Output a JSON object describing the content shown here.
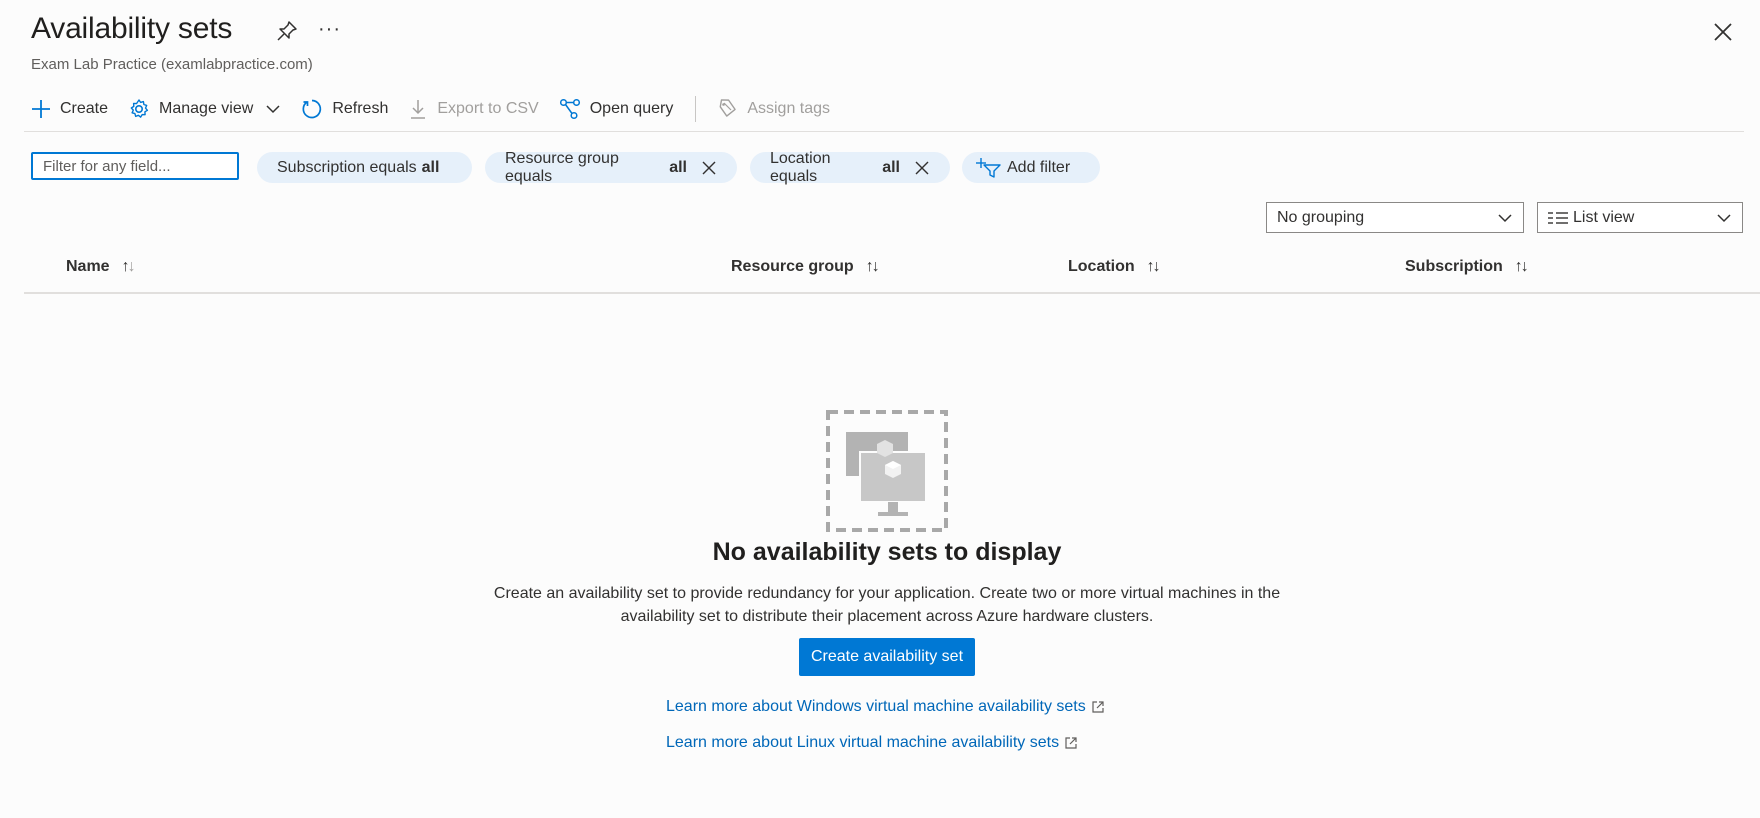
{
  "header": {
    "title": "Availability sets",
    "subtitle": "Exam Lab Practice (examlabpractice.com)",
    "more": "···"
  },
  "toolbar": {
    "create": "Create",
    "manage_view": "Manage view",
    "refresh": "Refresh",
    "export_csv": "Export to CSV",
    "open_query": "Open query",
    "assign_tags": "Assign tags"
  },
  "filters": {
    "search_placeholder": "Filter for any field...",
    "subscription": {
      "label": "Subscription equals",
      "value": "all"
    },
    "resource_group": {
      "label": "Resource group equals",
      "value": "all"
    },
    "location": {
      "label": "Location equals",
      "value": "all"
    },
    "add_filter": "Add filter"
  },
  "view": {
    "grouping": "No grouping",
    "layout": "List view"
  },
  "table": {
    "columns": [
      "Name",
      "Resource group",
      "Location",
      "Subscription"
    ]
  },
  "empty_state": {
    "title": "No availability sets to display",
    "description_line1": "Create an availability set to provide redundancy for your application. Create two or more virtual machines in the",
    "description_line2": "availability set to distribute their placement across Azure hardware clusters.",
    "button": "Create availability set",
    "link_windows": "Learn more about Windows virtual machine availability sets",
    "link_linux": "Learn more about Linux virtual machine availability sets"
  },
  "colors": {
    "accent": "#0078d4",
    "link": "#0067b8",
    "pill_bg": "#e6f0fa"
  },
  "icons": [
    "pin-icon",
    "more-icon",
    "close-icon",
    "plus-icon",
    "gear-icon",
    "chevron-down-icon",
    "refresh-icon",
    "download-icon",
    "query-icon",
    "tag-icon",
    "dismiss-icon",
    "add-filter-icon",
    "list-icon",
    "external-link-icon"
  ]
}
